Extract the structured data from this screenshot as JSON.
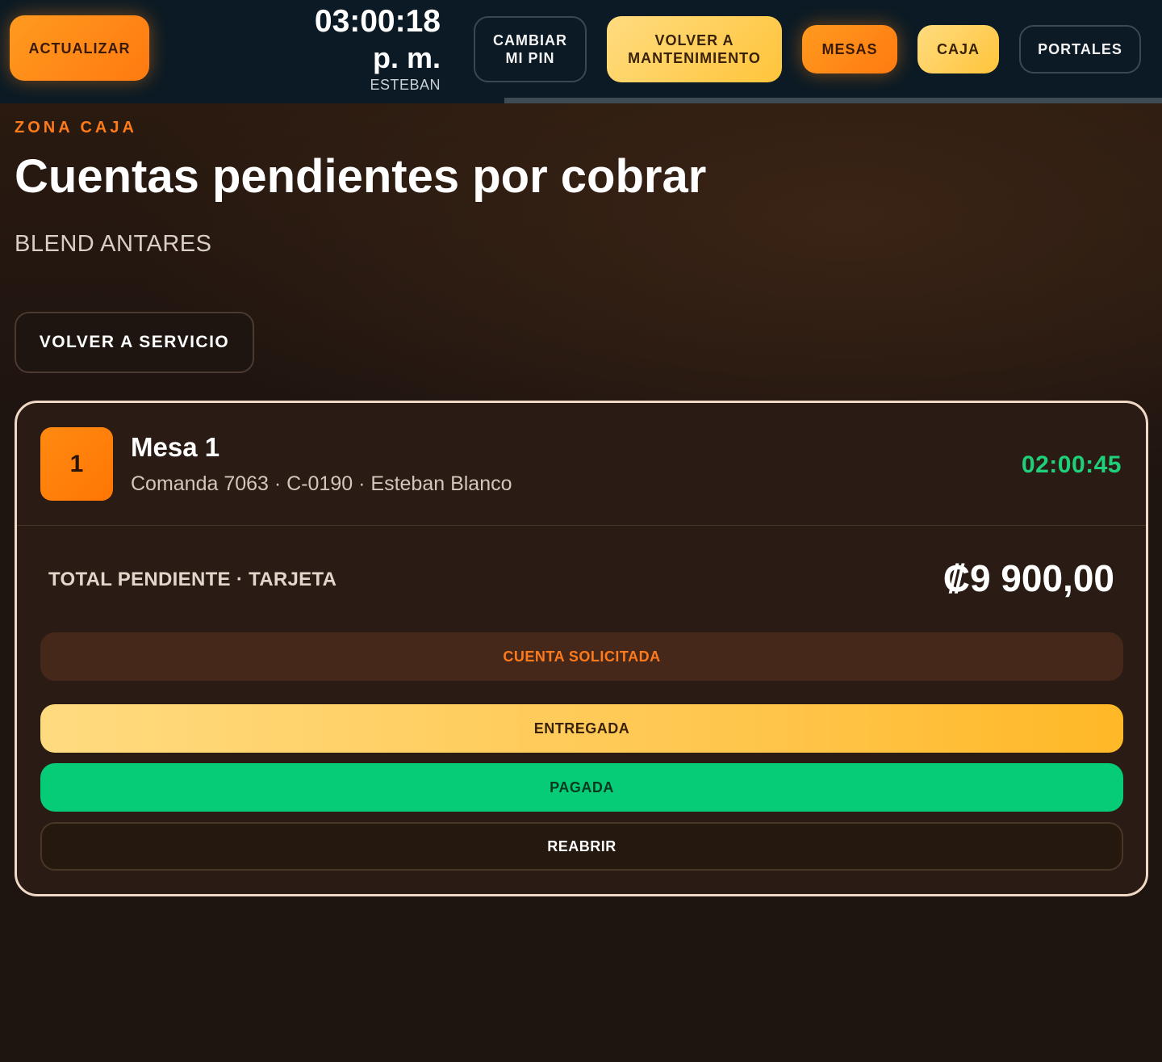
{
  "header": {
    "refresh_label": "ACTUALIZAR",
    "clock_time": "03:00:18",
    "clock_ampm": "p. m.",
    "user_name": "ESTEBAN",
    "change_pin_label": "CAMBIAR MI PIN",
    "back_maintenance_label": "VOLVER A MANTENIMIENTO",
    "tables_label": "MESAS",
    "cashier_label": "CAJA",
    "portals_label": "PORTALES"
  },
  "page": {
    "zone_label": "ZONA CAJA",
    "title": "Cuentas pendientes por cobrar",
    "venue": "BLEND ANTARES",
    "back_service_label": "VOLVER A SERVICIO"
  },
  "accounts": [
    {
      "table_number": "1",
      "table_name": "Mesa 1",
      "meta": "Comanda 7063 · C-0190 · Esteban Blanco",
      "elapsed": "02:00:45",
      "total_label": "TOTAL PENDIENTE · TARJETA",
      "total_amount": "₡9 900,00",
      "status_requested": "CUENTA SOLICITADA",
      "action_delivered": "ENTREGADA",
      "action_paid": "PAGADA",
      "action_reopen": "REABRIR"
    }
  ],
  "colors": {
    "accent_orange": "#ff7a1a",
    "accent_yellow": "#ffc43a",
    "success_green": "#06cc78",
    "header_bg": "#0b1a24",
    "page_bg": "#1e1410"
  }
}
